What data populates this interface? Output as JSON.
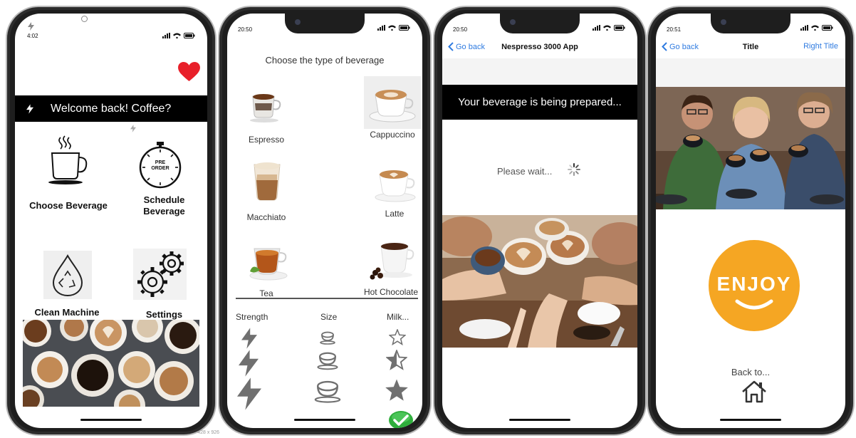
{
  "phone1": {
    "time": "4:02",
    "banner_text": "Welcome back! Coffee?",
    "tiles": [
      {
        "label": "Choose Beverage",
        "icon": "coffee-cup-icon"
      },
      {
        "label": "Schedule Beverage",
        "icon": "preorder-clock-icon"
      },
      {
        "label": "Clean Machine",
        "icon": "recycle-drop-icon"
      },
      {
        "label": "Settings",
        "icon": "gears-icon"
      }
    ],
    "preorder_line1": "PRE",
    "preorder_line2": "ORDER",
    "size_tag": "428 x 926",
    "favorite_icon": "heart-icon",
    "heart_color": "#e8202a"
  },
  "phone2": {
    "time": "20:50",
    "heading": "Choose the type of beverage",
    "beverages": [
      "Espresso",
      "Cappuccino",
      "Macchiato",
      "Latte",
      "Tea",
      "Hot Chocolate"
    ],
    "options": {
      "strength": "Strength",
      "size": "Size",
      "milk": "Milk..."
    },
    "confirm_icon": "checkmark-icon",
    "confirm_color": "#2fae3c"
  },
  "phone3": {
    "time": "20:50",
    "back_label": "Go back",
    "title": "Nespresso 3000 App",
    "banner_text": "Your beverage is being prepared...",
    "wait_text": "Please wait...",
    "accent": "#2f7be0"
  },
  "phone4": {
    "time": "20:51",
    "back_label": "Go back",
    "title": "Title",
    "right_title": "Right Title",
    "enjoy_text": "ENJOY",
    "back_to_label": "Back to...",
    "enjoy_color": "#f5a623"
  }
}
